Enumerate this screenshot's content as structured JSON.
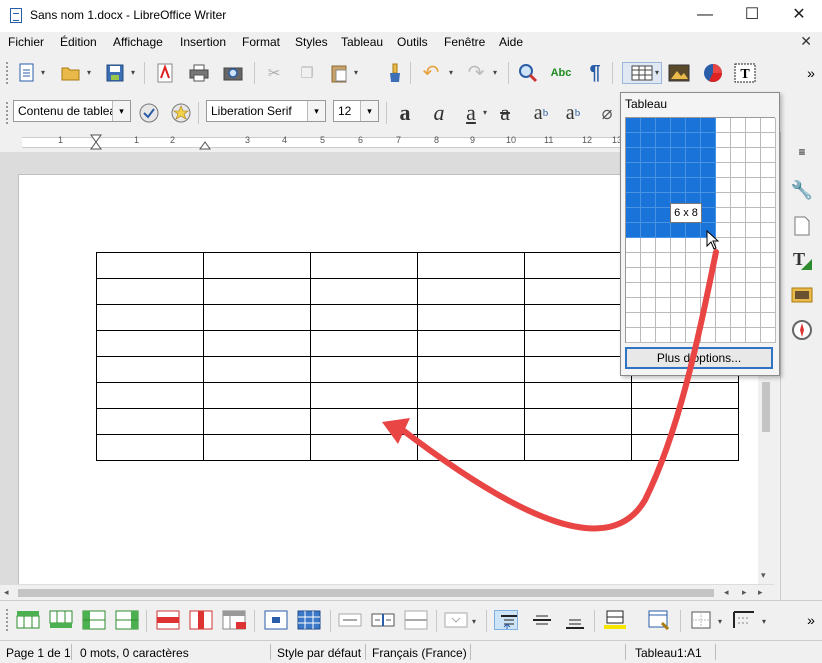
{
  "window": {
    "title": "Sans nom 1.docx - LibreOffice Writer",
    "minimize": "—",
    "maximize": "☐",
    "close": "✕"
  },
  "menu": {
    "items": [
      "Fichier",
      "Édition",
      "Affichage",
      "Insertion",
      "Format",
      "Styles",
      "Tableau",
      "Outils",
      "Fenêtre",
      "Aide"
    ],
    "close_doc": "✕"
  },
  "toolbar2": {
    "paragraph_style": "Contenu de tableau",
    "font_name": "Liberation Serif",
    "font_size": "12"
  },
  "ruler": {
    "numbers": [
      "1",
      "1",
      "2",
      "3",
      "4",
      "5",
      "6",
      "7",
      "8",
      "9",
      "10",
      "11",
      "12",
      "13"
    ]
  },
  "table_popup": {
    "title": "Tableau",
    "size_label": "6 x 8",
    "more_options": "Plus d'options...",
    "selected_cols": 6,
    "selected_rows": 8,
    "grid_cols": 10,
    "grid_rows": 15,
    "selection_color": "#1a73d8"
  },
  "document_table": {
    "rows": 8,
    "cols": 6
  },
  "statusbar": {
    "page": "Page 1 de 1",
    "words": "0 mots, 0 caractères",
    "style": "Style par défaut",
    "language": "Français (France)",
    "cell": "Tableau1:A1"
  },
  "annotation": {
    "arrow_color": "#e94545"
  }
}
